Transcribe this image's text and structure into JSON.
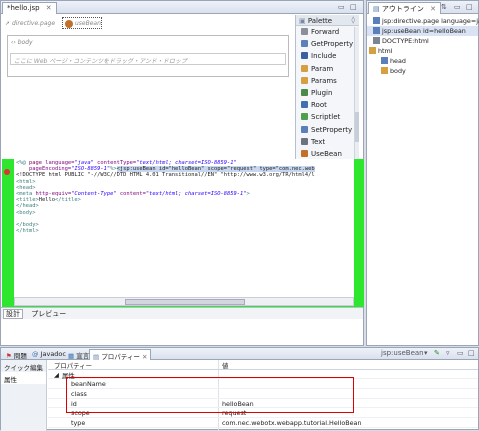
{
  "editor": {
    "tab_title": "*hello.jsp",
    "tab_close": "✕",
    "design": {
      "directive_label": "directive.page",
      "bean_label": "useBean",
      "body_label": "body",
      "drop_hint": "ここに Web ページ・コンテンツをドラッグ・アンド・ドロップ"
    },
    "palette": {
      "title": "Palette",
      "items": [
        {
          "label": "Forward",
          "icon_color": "#8a8f99"
        },
        {
          "label": "GetProperty",
          "icon_color": "#5b7fb8"
        },
        {
          "label": "Include",
          "icon_color": "#3a5f9e"
        },
        {
          "label": "Param",
          "icon_color": "#d4a042"
        },
        {
          "label": "Params",
          "icon_color": "#d4a042"
        },
        {
          "label": "Plugin",
          "icon_color": "#4c8a4c"
        },
        {
          "label": "Root",
          "icon_color": "#3f6fb0"
        },
        {
          "label": "Scriptlet",
          "icon_color": "#4f9f4f"
        },
        {
          "label": "SetProperty",
          "icon_color": "#5b7fb8"
        },
        {
          "label": "Text",
          "icon_color": "#6d7380"
        },
        {
          "label": "UseBean",
          "icon_color": "#c0702a"
        }
      ]
    },
    "source_lines": [
      [
        {
          "t": "<%@ ",
          "c": "tagc"
        },
        {
          "t": "page ",
          "c": "kw"
        },
        {
          "t": "language=",
          "c": "attr"
        },
        {
          "t": "\"java\"",
          "c": "str"
        },
        {
          "t": " contentType=",
          "c": "attr"
        },
        {
          "t": "\"text/html; charset=ISO-8859-1\"",
          "c": "str"
        }
      ],
      [
        {
          "t": "    pageEncoding=",
          "c": "attr"
        },
        {
          "t": "\"ISO-8859-1\"",
          "c": "str"
        },
        {
          "t": "%>",
          "c": "tagc"
        },
        {
          "t": "<jsp:useBean id=\"helloBean\" scope=\"request\" type=\"com.nec.web",
          "c": "hl"
        }
      ],
      [
        {
          "t": "<!DOCTYPE html PUBLIC \"-//W3C//DTD HTML 4.01 Transitional//EN\" \"http://www.w3.org/TR/html4/l",
          "c": ""
        }
      ],
      [
        {
          "t": "<html>",
          "c": "tagc"
        }
      ],
      [
        {
          "t": "<head>",
          "c": "tagc"
        }
      ],
      [
        {
          "t": "<meta ",
          "c": "tagc"
        },
        {
          "t": "http-equiv=",
          "c": "attr"
        },
        {
          "t": "\"Content-Type\"",
          "c": "str"
        },
        {
          "t": " content=",
          "c": "attr"
        },
        {
          "t": "\"text/html; charset=ISO-8859-1\"",
          "c": "str"
        },
        {
          "t": ">",
          "c": "tagc"
        }
      ],
      [
        {
          "t": "<title>",
          "c": "tagc"
        },
        {
          "t": "Hello",
          "c": ""
        },
        {
          "t": "</title>",
          "c": "tagc"
        }
      ],
      [
        {
          "t": "</head>",
          "c": "tagc"
        }
      ],
      [
        {
          "t": "<body>",
          "c": "tagc"
        }
      ],
      [
        {
          "t": "",
          "c": ""
        }
      ],
      [
        {
          "t": "</body>",
          "c": "tagc"
        }
      ],
      [
        {
          "t": "</html>",
          "c": "tagc"
        }
      ]
    ],
    "bottom_tabs": [
      "設計",
      "プレビュー"
    ]
  },
  "outline": {
    "tab_title": "アウトライン",
    "tab_close": "✕",
    "items": [
      {
        "label": "jsp:directive.page language=jav",
        "indent": 6,
        "selected": false,
        "icon_color": "#5b7fb8"
      },
      {
        "label": "jsp:useBean id=helloBean",
        "indent": 6,
        "selected": true,
        "icon_color": "#5b7fb8"
      },
      {
        "label": "DOCTYPE:html",
        "indent": 6,
        "selected": false,
        "icon_color": "#7b8594"
      },
      {
        "label": "html",
        "indent": 2,
        "selected": false,
        "icon_color": "#d4a042"
      },
      {
        "label": "head",
        "indent": 14,
        "selected": false,
        "icon_color": "#5b7fb8"
      },
      {
        "label": "body",
        "indent": 14,
        "selected": false,
        "icon_color": "#d4a042"
      }
    ]
  },
  "properties": {
    "tabs": [
      "問題",
      "Javadoc",
      "宣言",
      "プロパティー"
    ],
    "active_tab": "プロパティー",
    "selection_label": "jsp:useBean",
    "side_tabs": [
      "クイック編集",
      "属性"
    ],
    "header_col1": "プロパティー",
    "header_col2": "値",
    "group": "属性",
    "rows": [
      {
        "name": "beanName",
        "value": ""
      },
      {
        "name": "class",
        "value": ""
      },
      {
        "name": "id",
        "value": "helloBean"
      },
      {
        "name": "scope",
        "value": "request"
      },
      {
        "name": "type",
        "value": "com.nec.webotx.webapp.tutorial.HelloBean"
      }
    ]
  }
}
